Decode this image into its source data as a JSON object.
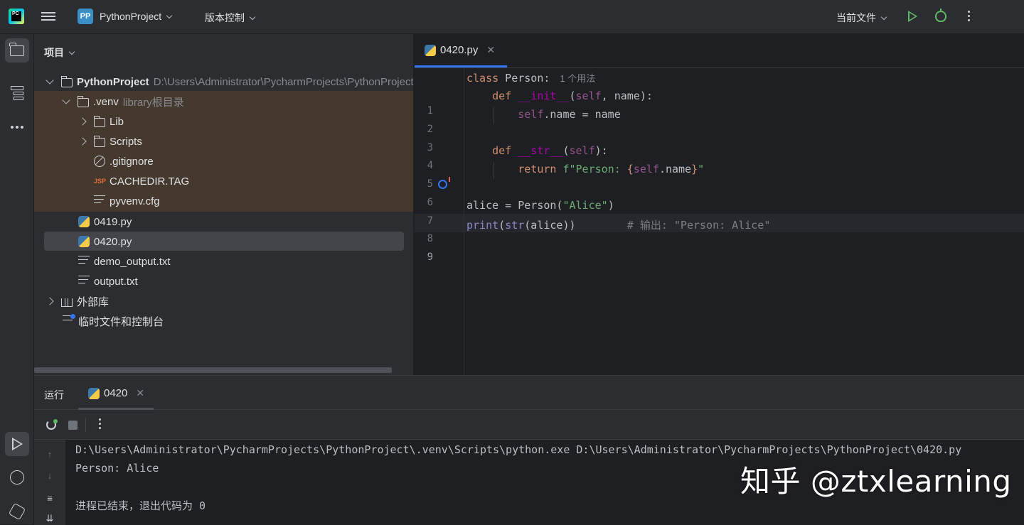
{
  "titlebar": {
    "project_badge": "PP",
    "project_name": "PythonProject",
    "vcs_menu": "版本控制",
    "run_config": "当前文件"
  },
  "project_panel": {
    "title": "项目",
    "tree": {
      "root": {
        "name": "PythonProject",
        "path": "D:\\Users\\Administrator\\PycharmProjects\\PythonProject"
      },
      "venv": {
        "name": ".venv",
        "hint": "library根目录"
      },
      "lib": "Lib",
      "scripts": "Scripts",
      "gitignore": ".gitignore",
      "cachedir": "CACHEDIR.TAG",
      "pyvenv": "pyvenv.cfg",
      "file_0419": "0419.py",
      "file_0420": "0420.py",
      "demo_output": "demo_output.txt",
      "output": "output.txt",
      "external_libs": "外部库",
      "scratches": "临时文件和控制台"
    }
  },
  "editor": {
    "tab_label": "0420.py",
    "line_numbers": [
      "1",
      "2",
      "3",
      "4",
      "5",
      "6",
      "7",
      "8",
      "9"
    ],
    "code": {
      "l1_kw": "class",
      "l1_name": " Person:",
      "l1_hint": "1 个用法",
      "l2_indent": "    ",
      "l2_kw": "def",
      "l2_fn": "__init__",
      "l2_p1": "(",
      "l2_self": "self",
      "l2_rest": ", name):",
      "l3_indent": "        ",
      "l3_self": "self",
      "l3_rest": ".name = name",
      "l5_indent": "    ",
      "l5_kw": "def",
      "l5_fn": "__str__",
      "l5_p1": "(",
      "l5_self": "self",
      "l5_rest": "):",
      "l6_indent": "        ",
      "l6_kw": "return",
      "l6_str1": " f\"Person: ",
      "l6_brace1": "{",
      "l6_self": "self",
      "l6_attr": ".name",
      "l6_brace2": "}",
      "l6_str2": "\"",
      "l8_a": "alice = Person(",
      "l8_str": "\"Alice\"",
      "l8_b": ")",
      "l9_print": "print",
      "l9_p1": "(",
      "l9_str": "str",
      "l9_rest": "(alice))",
      "l9_comment": "        # 输出: \"Person: Alice\""
    }
  },
  "run_panel": {
    "title": "运行",
    "tab_label": "0420",
    "console": {
      "command": "D:\\Users\\Administrator\\PycharmProjects\\PythonProject\\.venv\\Scripts\\python.exe D:\\Users\\Administrator\\PycharmProjects\\PythonProject\\0420.py",
      "output": "Person: Alice",
      "exit": "进程已结束，退出代码为 0"
    }
  },
  "watermark": "知乎 @ztxlearning",
  "colors": {
    "accent": "#3574f0",
    "run_green": "#5fb865",
    "venv_highlight": "#45392d"
  }
}
